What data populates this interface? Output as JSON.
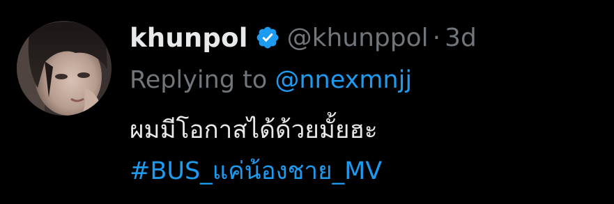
{
  "tweet": {
    "author": {
      "display_name": "khunpol",
      "handle": "@khunppol",
      "verified_icon": "verified-badge-icon",
      "avatar": "avatar-photo"
    },
    "separator": "·",
    "time": "3d",
    "reply": {
      "prefix": "Replying to",
      "mention": "@nnexmnjj"
    },
    "body": {
      "text": "ผมมีโอกาสได้ด้วยมั้ยฮะ",
      "hashtag": "#BUS_แค่น้องชาย_MV"
    }
  },
  "colors": {
    "background": "#000000",
    "primary_text": "#e7e9ea",
    "secondary_text": "#71767b",
    "accent": "#1d9bf0"
  }
}
